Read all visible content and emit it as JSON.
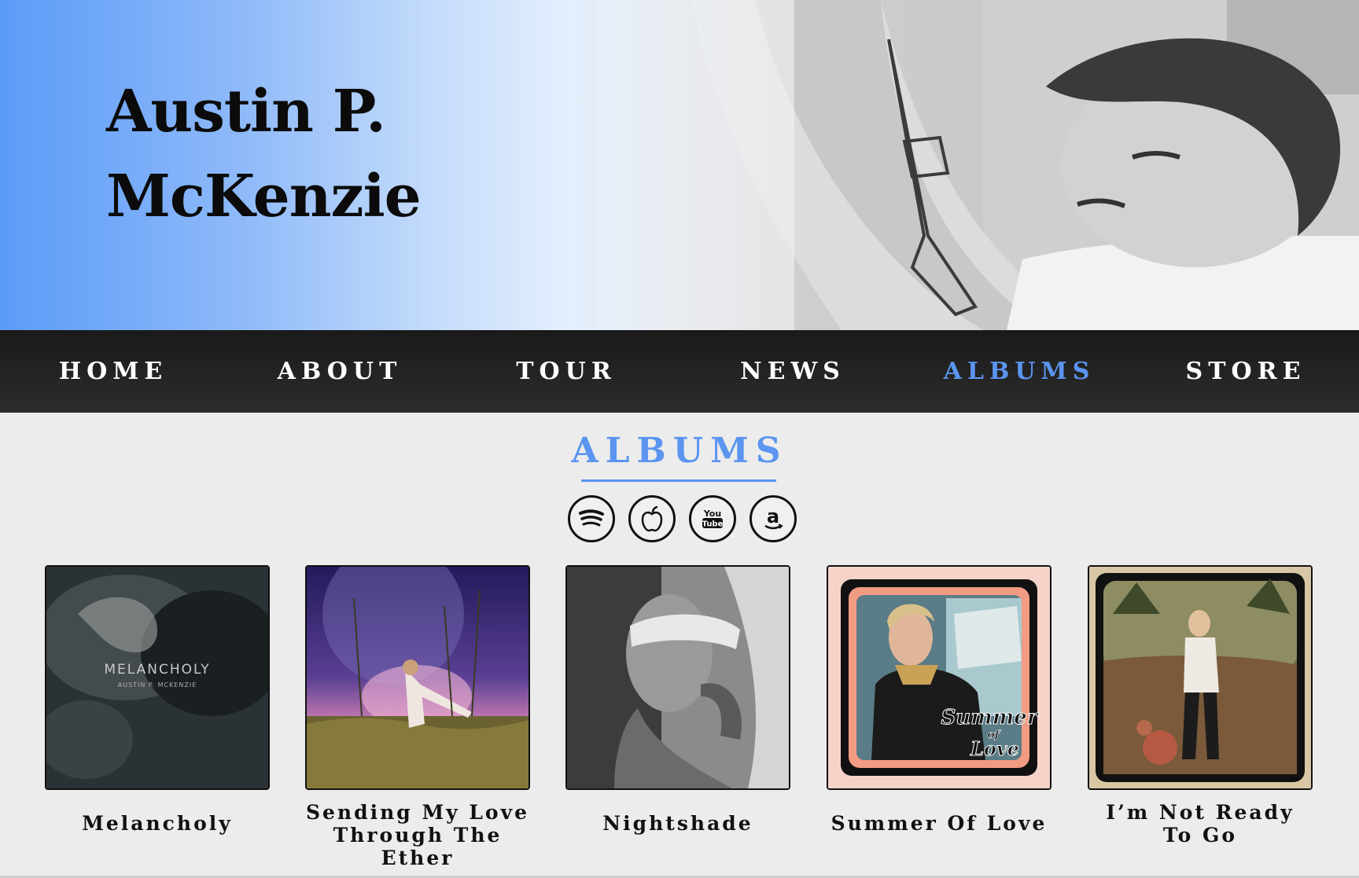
{
  "artist": {
    "name_line1": "Austin P.",
    "name_line2": "McKenzie"
  },
  "nav": {
    "items": [
      {
        "label": "HOME"
      },
      {
        "label": "ABOUT"
      },
      {
        "label": "TOUR"
      },
      {
        "label": "NEWS"
      },
      {
        "label": "ALBUMS",
        "active": true
      },
      {
        "label": "STORE"
      }
    ]
  },
  "section": {
    "title": "ALBUMS"
  },
  "social": [
    "spotify-icon",
    "apple-music-icon",
    "youtube-icon",
    "amazon-music-icon"
  ],
  "albums": [
    {
      "title_line1": "Melancholy",
      "title_line2": "",
      "cover_text": "MELANCHOLY",
      "cover_subtext": "AUSTIN P. MCKENZIE"
    },
    {
      "title_line1": "Sending My Love",
      "title_line2": "Through The Ether"
    },
    {
      "title_line1": "Nightshade",
      "title_line2": ""
    },
    {
      "title_line1": "Summer Of Love",
      "title_line2": "",
      "cover_text_1": "Summer",
      "cover_text_2": "of",
      "cover_text_3": "Love"
    },
    {
      "title_line1": "I’m Not Ready",
      "title_line2": "To Go"
    }
  ],
  "colors": {
    "accent": "#5b95f0",
    "nav_bg": "#222222",
    "page_bg": "#ececec"
  }
}
